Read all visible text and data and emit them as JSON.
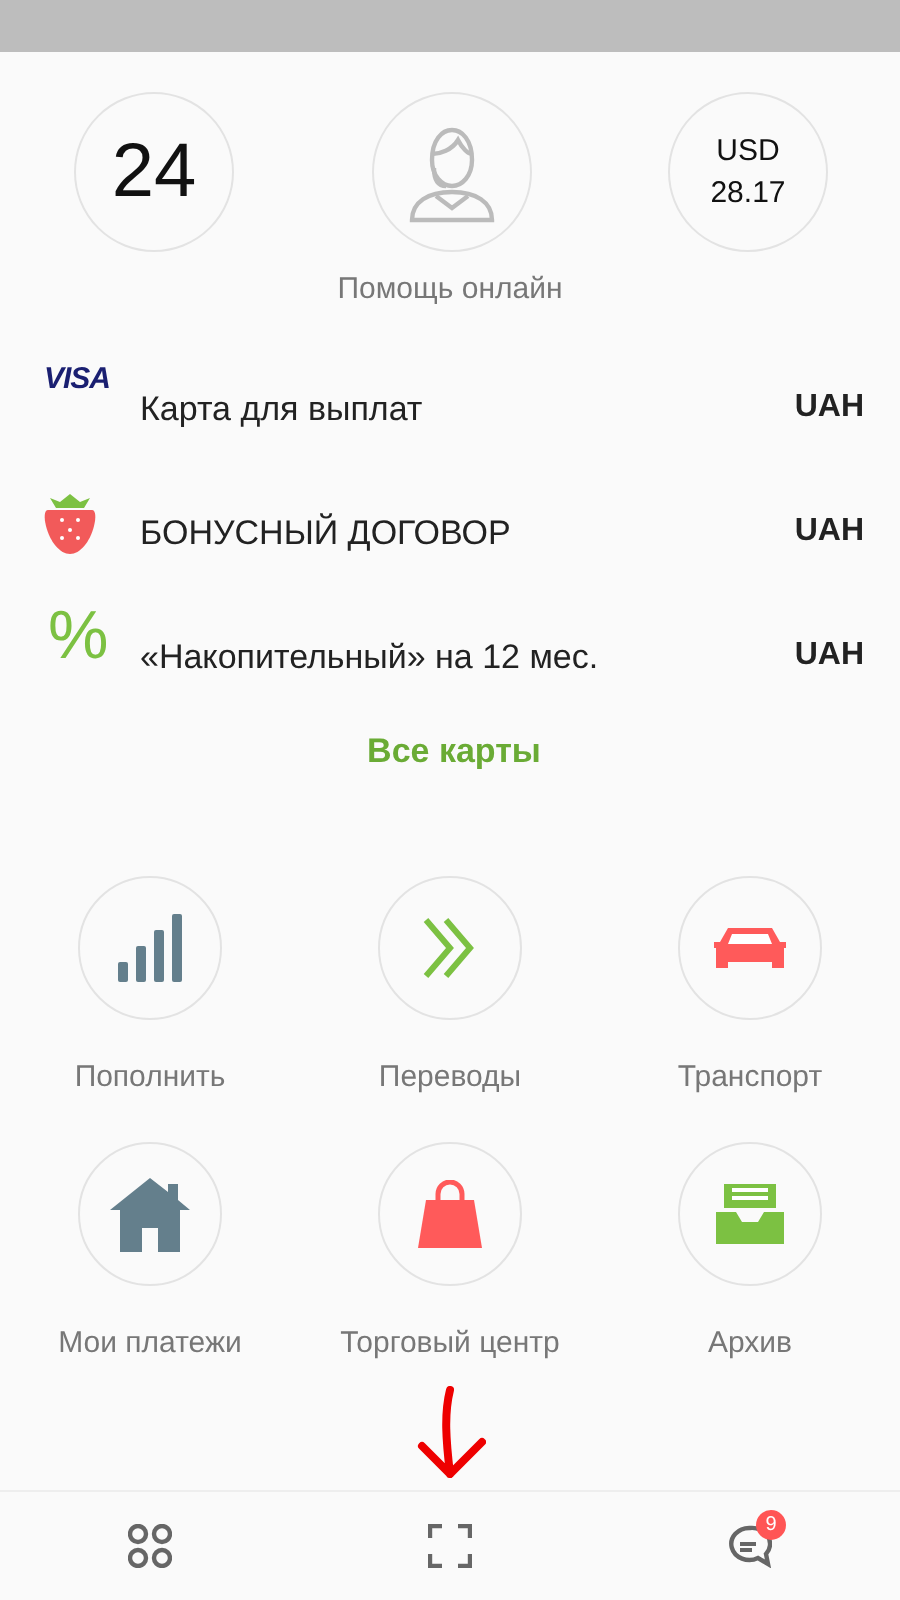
{
  "quick": [
    {
      "kind": "number",
      "lines": [
        "24"
      ]
    },
    {
      "kind": "support"
    },
    {
      "kind": "rate",
      "lines": [
        "USD",
        "28.17"
      ]
    }
  ],
  "support_label": "Помощь онлайн",
  "cards": [
    {
      "kind": "visa",
      "logo": "VISA",
      "name": "Карта для выплат",
      "currency": "UAH"
    },
    {
      "kind": "berry",
      "name": "БОНУСНЫЙ ДОГОВОР",
      "currency": "UAH"
    },
    {
      "kind": "percent",
      "logo": "%",
      "name": "«Накопительный» на 12 мес.",
      "currency": "UAH"
    }
  ],
  "all_cards": "Все карты",
  "services": [
    {
      "kind": "signal",
      "label": "Пополнить"
    },
    {
      "kind": "chevrons",
      "label": "Переводы"
    },
    {
      "kind": "car",
      "label": "Транспорт"
    },
    {
      "kind": "house",
      "label": "Мои платежи"
    },
    {
      "kind": "bag",
      "label": "Торговый центр"
    },
    {
      "kind": "tray",
      "label": "Архив"
    }
  ],
  "bottom_nav": [
    {
      "kind": "grid"
    },
    {
      "kind": "scan"
    },
    {
      "kind": "chat",
      "badge": "9"
    }
  ]
}
